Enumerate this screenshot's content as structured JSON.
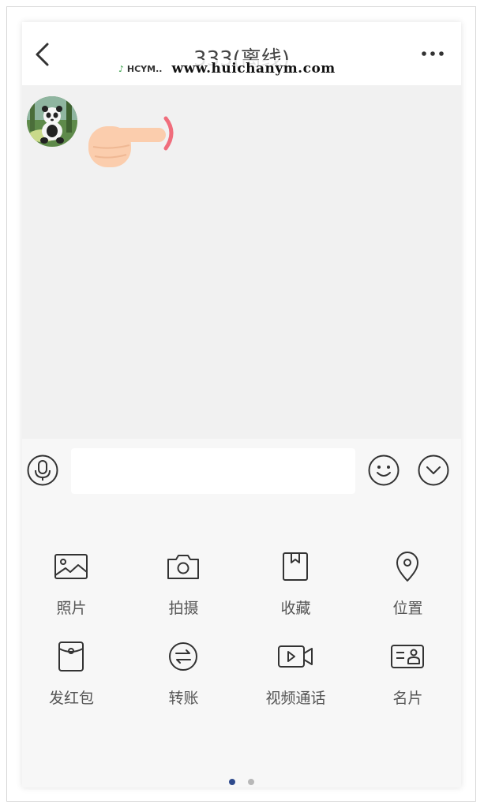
{
  "header": {
    "title": "333(离线)",
    "watermark_logo": "HCYM",
    "watermark_url": "www.huichanym.com"
  },
  "message": {
    "sender_avatar": "panda-avatar",
    "content_icon": "pointing-hand-icon"
  },
  "input": {
    "value": "",
    "voice_icon": "microphone-icon",
    "emoji_icon": "smiley-icon",
    "toggle_icon": "chevron-down-icon"
  },
  "panel": {
    "items": [
      {
        "label": "照片",
        "icon": "photo-icon"
      },
      {
        "label": "拍摄",
        "icon": "camera-icon"
      },
      {
        "label": "收藏",
        "icon": "bookmark-icon"
      },
      {
        "label": "位置",
        "icon": "location-pin-icon"
      },
      {
        "label": "发红包",
        "icon": "red-packet-icon"
      },
      {
        "label": "转账",
        "icon": "transfer-icon"
      },
      {
        "label": "视频通话",
        "icon": "video-call-icon"
      },
      {
        "label": "名片",
        "icon": "contact-card-icon"
      }
    ],
    "page_count": 2,
    "current_page": 1
  }
}
